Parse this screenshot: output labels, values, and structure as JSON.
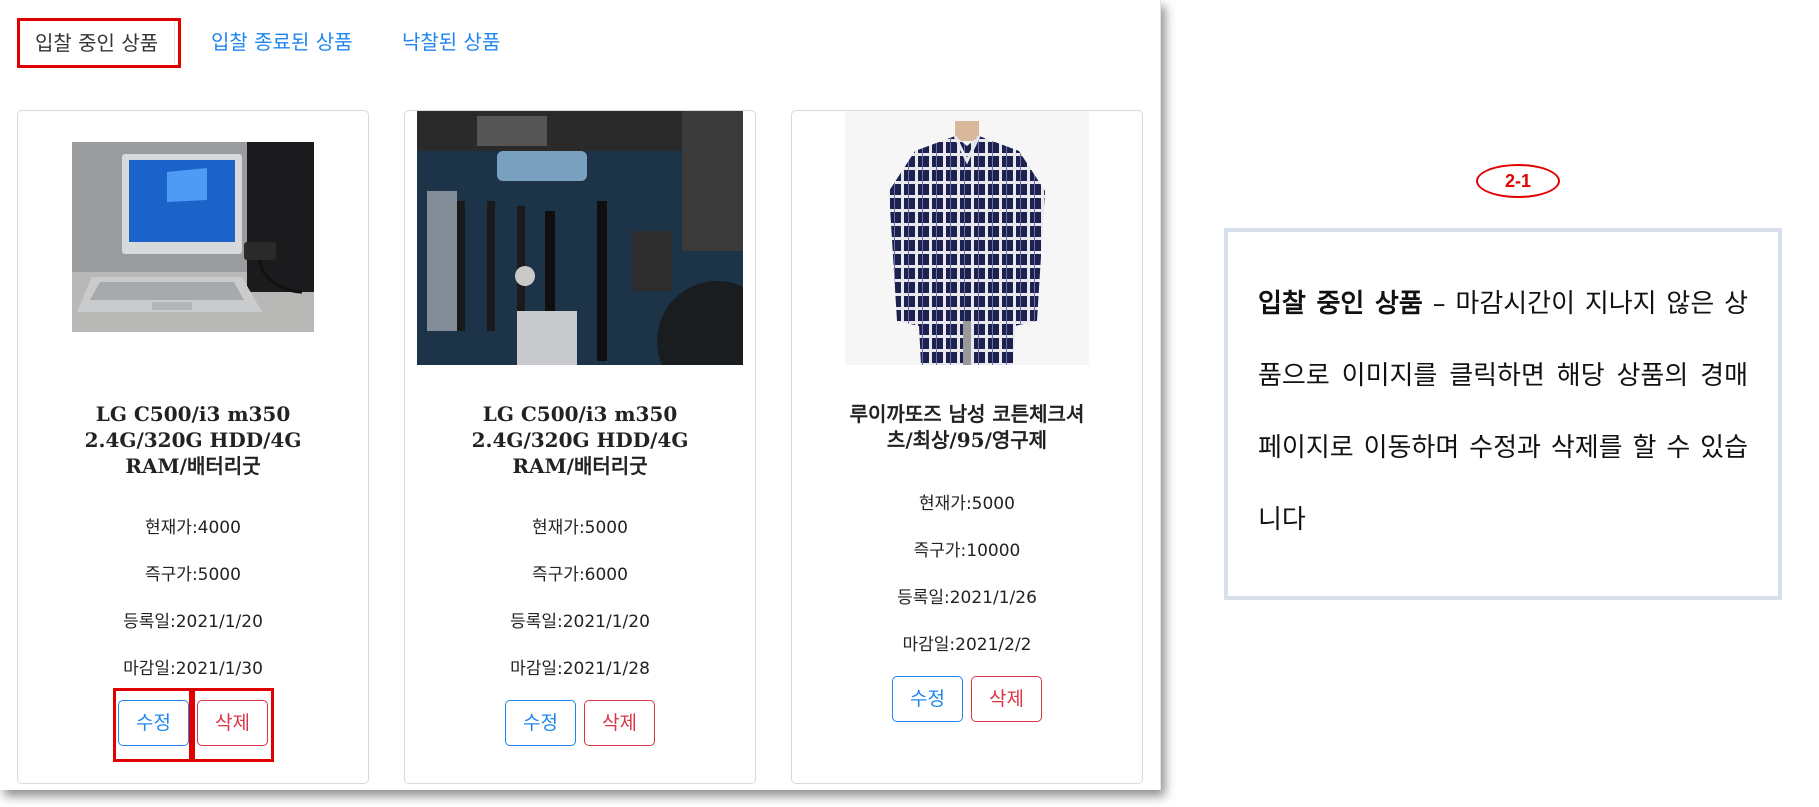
{
  "tabs": [
    {
      "label": "입찰 중인 상품",
      "active": true
    },
    {
      "label": "입찰 종료된 상품",
      "active": false
    },
    {
      "label": "낙찰된 상품",
      "active": false
    }
  ],
  "colors": {
    "link": "#1f86f0",
    "danger": "#dc3545",
    "highlight": "#e00000"
  },
  "products": [
    {
      "image": "laptop-photo",
      "title_lines": [
        "LG C500/i3 m350",
        "2.4G/320G HDD/4G",
        "RAM/배터리굿"
      ],
      "current_price": "현재가:4000",
      "buy_now_price": "즉구가:5000",
      "registered": "등록일:2021/1/20",
      "deadline": "마감일:2021/1/30",
      "edit_label": "수정",
      "delete_label": "삭제"
    },
    {
      "image": "motherboard-photo",
      "title_lines": [
        "LG C500/i3 m350",
        "2.4G/320G HDD/4G",
        "RAM/배터리굿"
      ],
      "current_price": "현재가:5000",
      "buy_now_price": "즉구가:6000",
      "registered": "등록일:2021/1/20",
      "deadline": "마감일:2021/1/28",
      "edit_label": "수정",
      "delete_label": "삭제"
    },
    {
      "image": "plaid-shirt-photo",
      "title_lines": [
        "루이까또즈 남성 코튼체크셔",
        "츠/최상/95/영구제"
      ],
      "current_price": "현재가:5000",
      "buy_now_price": "즉구가:10000",
      "registered": "등록일:2021/1/26",
      "deadline": "마감일:2021/2/2",
      "edit_label": "수정",
      "delete_label": "삭제"
    }
  ],
  "annotation": {
    "badge": "2-1",
    "bold_term": "입찰 중인 상품",
    "text": " – 마감시간이 지나지 않은 상품으로 이미지를 클릭하면 해당 상품의 경매 페이지로 이동하며 수정과 삭제를 할 수 있습니다"
  }
}
